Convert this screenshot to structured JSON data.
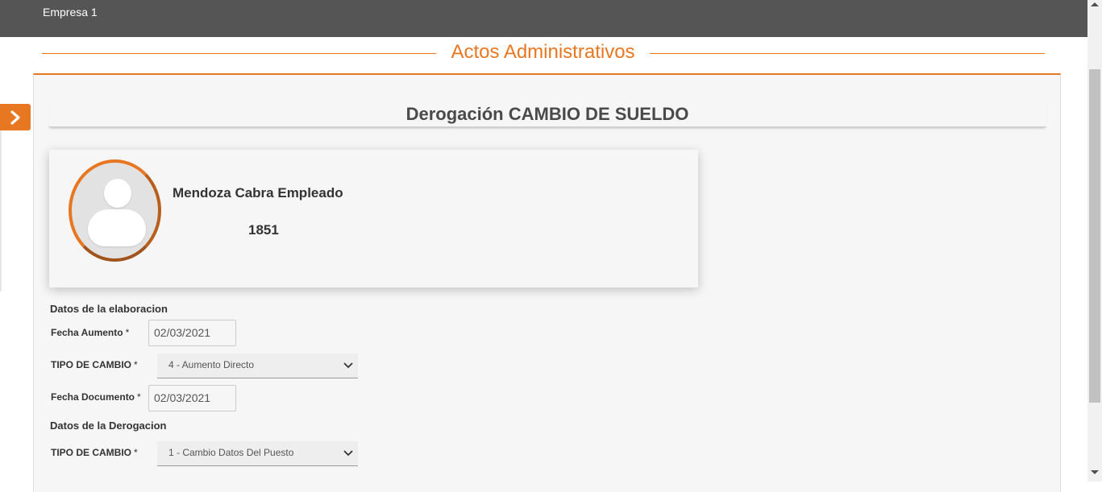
{
  "topbar": {
    "company": "Empresa 1"
  },
  "section": {
    "title": "Actos Administrativos"
  },
  "page": {
    "title": "Derogación CAMBIO DE SUELDO"
  },
  "employee": {
    "name": "Mendoza Cabra Empleado",
    "id": "1851"
  },
  "elaboracion": {
    "group_label": "Datos de la elaboracion",
    "fecha_aumento": {
      "label": "Fecha Aumento",
      "value": "02/03/2021"
    },
    "tipo_cambio": {
      "label": "TIPO DE CAMBIO",
      "value": "4 - Aumento Directo"
    },
    "fecha_documento": {
      "label": "Fecha Documento",
      "value": "02/03/2021"
    }
  },
  "derogacion": {
    "group_label": "Datos de la Derogacion",
    "tipo_cambio": {
      "label": "TIPO DE CAMBIO",
      "value": "1 - Cambio Datos Del Puesto"
    }
  },
  "required_mark": "*",
  "colors": {
    "accent": "#e87722",
    "topbar": "#555555"
  }
}
